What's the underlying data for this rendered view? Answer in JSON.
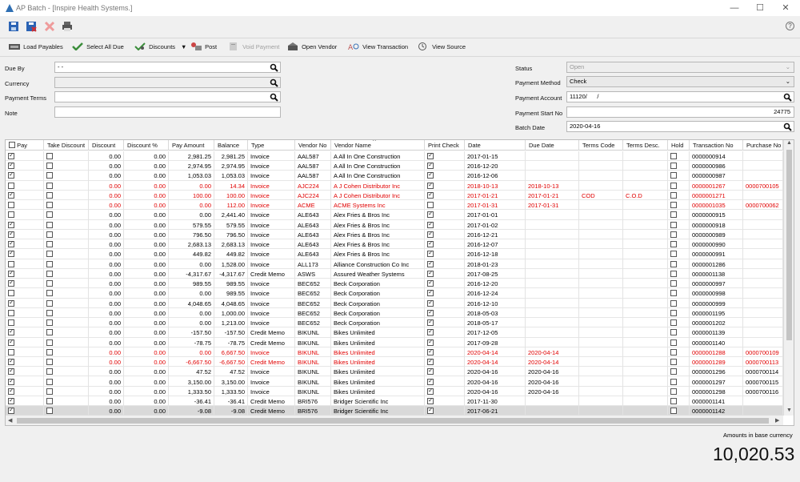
{
  "window": {
    "app_name": "AP Batch",
    "separator": "-",
    "company": "[Inspire Health Systems.]",
    "min_icon": "minimize-icon",
    "max_icon": "maximize-icon",
    "close_icon": "close-icon",
    "title_icon": "app-logo-icon"
  },
  "toolbar": {
    "help": "?",
    "buttons": [
      {
        "label": "Load Payables",
        "icon": "load-icon"
      },
      {
        "label": "Select All Due",
        "icon": "check-icon"
      },
      {
        "label": "Discounts",
        "icon": "discount-icon"
      },
      {
        "label": "▼",
        "icon": "dropdown-icon"
      },
      {
        "label": "Post",
        "icon": "post-icon"
      },
      {
        "label": "Void Payment",
        "icon": "void-icon"
      },
      {
        "label": "Open Vendor",
        "icon": "vendor-icon"
      },
      {
        "label": "View Transaction",
        "icon": "transaction-icon"
      },
      {
        "label": "View Source",
        "icon": "source-icon"
      }
    ]
  },
  "form": {
    "left": {
      "due_by_label": "Due By",
      "due_by_value": "- -",
      "currency_label": "Currency",
      "currency_value": "",
      "payment_terms_label": "Payment Terms",
      "payment_terms_value": "",
      "note_label": "Note",
      "note_value": ""
    },
    "right": {
      "status_label": "Status",
      "status_value": "Open",
      "payment_method_label": "Payment Method",
      "payment_method_value": "Check",
      "payment_account_label": "Payment Account",
      "payment_account_value": "11120/      /",
      "payment_start_label": "Payment Start No",
      "payment_start_value": "24775",
      "batch_date_label": "Batch Date",
      "batch_date_value": "2020-04-16"
    }
  },
  "grid": {
    "columns": [
      "Pay",
      "Take Discount",
      "Discount",
      "Discount %",
      "Pay Amount",
      "Balance",
      "Type",
      "Vendor No",
      "Vendor Name",
      "Print Check",
      "Date",
      "Due Date",
      "Terms Code",
      "Terms Desc.",
      "Hold",
      "Transaction No",
      "Purchase No"
    ],
    "sort_indicator": "^",
    "rows": [
      {
        "pay": true,
        "take": false,
        "discount": "0.00",
        "disc_pct": "0.00",
        "pay_amount": "2,981.25",
        "balance": "2,981.25",
        "type": "Invoice",
        "vendor_no": "AAL587",
        "vendor_name": "A All In One Construction",
        "print": true,
        "date": "2017-01-15",
        "due": "",
        "terms_code": "",
        "terms_desc": "",
        "hold": false,
        "trans": "0000000914",
        "purchase": "",
        "red": false
      },
      {
        "pay": true,
        "take": false,
        "discount": "0.00",
        "disc_pct": "0.00",
        "pay_amount": "2,974.95",
        "balance": "2,974.95",
        "type": "Invoice",
        "vendor_no": "AAL587",
        "vendor_name": "A All In One Construction",
        "print": true,
        "date": "2016-12-20",
        "due": "",
        "terms_code": "",
        "terms_desc": "",
        "hold": false,
        "trans": "0000000986",
        "purchase": "",
        "red": false
      },
      {
        "pay": true,
        "take": false,
        "discount": "0.00",
        "disc_pct": "0.00",
        "pay_amount": "1,053.03",
        "balance": "1,053.03",
        "type": "Invoice",
        "vendor_no": "AAL587",
        "vendor_name": "A All In One Construction",
        "print": true,
        "date": "2016-12-06",
        "due": "",
        "terms_code": "",
        "terms_desc": "",
        "hold": false,
        "trans": "0000000987",
        "purchase": "",
        "red": false
      },
      {
        "pay": false,
        "take": false,
        "discount": "0.00",
        "disc_pct": "0.00",
        "pay_amount": "0.00",
        "balance": "14.34",
        "type": "Invoice",
        "vendor_no": "AJC224",
        "vendor_name": "A J Cohen Distributor Inc",
        "print": true,
        "date": "2018-10-13",
        "due": "2018-10-13",
        "terms_code": "",
        "terms_desc": "",
        "hold": false,
        "trans": "0000001267",
        "purchase": "0000700105",
        "red": true
      },
      {
        "pay": true,
        "take": false,
        "discount": "0.00",
        "disc_pct": "0.00",
        "pay_amount": "100.00",
        "balance": "100.00",
        "type": "Invoice",
        "vendor_no": "AJC224",
        "vendor_name": "A J Cohen Distributor Inc",
        "print": true,
        "date": "2017-01-21",
        "due": "2017-01-21",
        "terms_code": "COD",
        "terms_desc": "C.O.D",
        "hold": false,
        "trans": "0000001271",
        "purchase": "",
        "red": true
      },
      {
        "pay": false,
        "take": false,
        "discount": "0.00",
        "disc_pct": "0.00",
        "pay_amount": "0.00",
        "balance": "112.00",
        "type": "Invoice",
        "vendor_no": "ACME",
        "vendor_name": "ACME Systems Inc",
        "print": false,
        "date": "2017-01-31",
        "due": "2017-01-31",
        "terms_code": "",
        "terms_desc": "",
        "hold": false,
        "trans": "0000001035",
        "purchase": "0000700062",
        "red": true
      },
      {
        "pay": false,
        "take": false,
        "discount": "0.00",
        "disc_pct": "0.00",
        "pay_amount": "0.00",
        "balance": "2,441.40",
        "type": "Invoice",
        "vendor_no": "ALE643",
        "vendor_name": "Alex Fries & Bros Inc",
        "print": true,
        "date": "2017-01-01",
        "due": "",
        "terms_code": "",
        "terms_desc": "",
        "hold": false,
        "trans": "0000000915",
        "purchase": "",
        "red": false
      },
      {
        "pay": true,
        "take": false,
        "discount": "0.00",
        "disc_pct": "0.00",
        "pay_amount": "579.55",
        "balance": "579.55",
        "type": "Invoice",
        "vendor_no": "ALE643",
        "vendor_name": "Alex Fries & Bros Inc",
        "print": true,
        "date": "2017-01-02",
        "due": "",
        "terms_code": "",
        "terms_desc": "",
        "hold": false,
        "trans": "0000000918",
        "purchase": "",
        "red": false
      },
      {
        "pay": true,
        "take": false,
        "discount": "0.00",
        "disc_pct": "0.00",
        "pay_amount": "796.50",
        "balance": "796.50",
        "type": "Invoice",
        "vendor_no": "ALE643",
        "vendor_name": "Alex Fries & Bros Inc",
        "print": true,
        "date": "2016-12-21",
        "due": "",
        "terms_code": "",
        "terms_desc": "",
        "hold": false,
        "trans": "0000000989",
        "purchase": "",
        "red": false
      },
      {
        "pay": true,
        "take": false,
        "discount": "0.00",
        "disc_pct": "0.00",
        "pay_amount": "2,683.13",
        "balance": "2,683.13",
        "type": "Invoice",
        "vendor_no": "ALE643",
        "vendor_name": "Alex Fries & Bros Inc",
        "print": true,
        "date": "2016-12-07",
        "due": "",
        "terms_code": "",
        "terms_desc": "",
        "hold": false,
        "trans": "0000000990",
        "purchase": "",
        "red": false
      },
      {
        "pay": true,
        "take": false,
        "discount": "0.00",
        "disc_pct": "0.00",
        "pay_amount": "449.82",
        "balance": "449.82",
        "type": "Invoice",
        "vendor_no": "ALE643",
        "vendor_name": "Alex Fries & Bros Inc",
        "print": true,
        "date": "2016-12-18",
        "due": "",
        "terms_code": "",
        "terms_desc": "",
        "hold": false,
        "trans": "0000000991",
        "purchase": "",
        "red": false
      },
      {
        "pay": false,
        "take": false,
        "discount": "0.00",
        "disc_pct": "0.00",
        "pay_amount": "0.00",
        "balance": "1,528.00",
        "type": "Invoice",
        "vendor_no": "ALL173",
        "vendor_name": "Alliance Construction Co Inc",
        "print": true,
        "date": "2018-01-23",
        "due": "",
        "terms_code": "",
        "terms_desc": "",
        "hold": false,
        "trans": "0000001286",
        "purchase": "",
        "red": false
      },
      {
        "pay": true,
        "take": false,
        "discount": "0.00",
        "disc_pct": "0.00",
        "pay_amount": "-4,317.67",
        "balance": "-4,317.67",
        "type": "Credit Memo",
        "vendor_no": "ASWS",
        "vendor_name": "Assured Weather Systems",
        "print": true,
        "date": "2017-08-25",
        "due": "",
        "terms_code": "",
        "terms_desc": "",
        "hold": false,
        "trans": "0000001138",
        "purchase": "",
        "red": false
      },
      {
        "pay": true,
        "take": false,
        "discount": "0.00",
        "disc_pct": "0.00",
        "pay_amount": "989.55",
        "balance": "989.55",
        "type": "Invoice",
        "vendor_no": "BEC652",
        "vendor_name": "Beck Corporation",
        "print": true,
        "date": "2016-12-20",
        "due": "",
        "terms_code": "",
        "terms_desc": "",
        "hold": false,
        "trans": "0000000997",
        "purchase": "",
        "red": false
      },
      {
        "pay": false,
        "take": false,
        "discount": "0.00",
        "disc_pct": "0.00",
        "pay_amount": "0.00",
        "balance": "989.55",
        "type": "Invoice",
        "vendor_no": "BEC652",
        "vendor_name": "Beck Corporation",
        "print": true,
        "date": "2016-12-24",
        "due": "",
        "terms_code": "",
        "terms_desc": "",
        "hold": false,
        "trans": "0000000998",
        "purchase": "",
        "red": false
      },
      {
        "pay": true,
        "take": false,
        "discount": "0.00",
        "disc_pct": "0.00",
        "pay_amount": "4,048.65",
        "balance": "4,048.65",
        "type": "Invoice",
        "vendor_no": "BEC652",
        "vendor_name": "Beck Corporation",
        "print": true,
        "date": "2016-12-10",
        "due": "",
        "terms_code": "",
        "terms_desc": "",
        "hold": false,
        "trans": "0000000999",
        "purchase": "",
        "red": false
      },
      {
        "pay": false,
        "take": false,
        "discount": "0.00",
        "disc_pct": "0.00",
        "pay_amount": "0.00",
        "balance": "1,000.00",
        "type": "Invoice",
        "vendor_no": "BEC652",
        "vendor_name": "Beck Corporation",
        "print": true,
        "date": "2018-05-03",
        "due": "",
        "terms_code": "",
        "terms_desc": "",
        "hold": false,
        "trans": "0000001195",
        "purchase": "",
        "red": false
      },
      {
        "pay": false,
        "take": false,
        "discount": "0.00",
        "disc_pct": "0.00",
        "pay_amount": "0.00",
        "balance": "1,213.00",
        "type": "Invoice",
        "vendor_no": "BEC652",
        "vendor_name": "Beck Corporation",
        "print": true,
        "date": "2018-05-17",
        "due": "",
        "terms_code": "",
        "terms_desc": "",
        "hold": false,
        "trans": "0000001202",
        "purchase": "",
        "red": false
      },
      {
        "pay": true,
        "take": false,
        "discount": "0.00",
        "disc_pct": "0.00",
        "pay_amount": "-157.50",
        "balance": "-157.50",
        "type": "Credit Memo",
        "vendor_no": "BIKUNL",
        "vendor_name": "Bikes Unlimited",
        "print": true,
        "date": "2017-12-05",
        "due": "",
        "terms_code": "",
        "terms_desc": "",
        "hold": false,
        "trans": "0000001139",
        "purchase": "",
        "red": false
      },
      {
        "pay": true,
        "take": false,
        "discount": "0.00",
        "disc_pct": "0.00",
        "pay_amount": "-78.75",
        "balance": "-78.75",
        "type": "Credit Memo",
        "vendor_no": "BIKUNL",
        "vendor_name": "Bikes Unlimited",
        "print": true,
        "date": "2017-09-28",
        "due": "",
        "terms_code": "",
        "terms_desc": "",
        "hold": false,
        "trans": "0000001140",
        "purchase": "",
        "red": false
      },
      {
        "pay": false,
        "take": false,
        "discount": "0.00",
        "disc_pct": "0.00",
        "pay_amount": "0.00",
        "balance": "6,667.50",
        "type": "Invoice",
        "vendor_no": "BIKUNL",
        "vendor_name": "Bikes Unlimited",
        "print": true,
        "date": "2020-04-14",
        "due": "2020-04-14",
        "terms_code": "",
        "terms_desc": "",
        "hold": false,
        "trans": "0000001288",
        "purchase": "0000700109",
        "red": true
      },
      {
        "pay": true,
        "take": false,
        "discount": "0.00",
        "disc_pct": "0.00",
        "pay_amount": "-6,667.50",
        "balance": "-6,667.50",
        "type": "Credit Memo",
        "vendor_no": "BIKUNL",
        "vendor_name": "Bikes Unlimited",
        "print": true,
        "date": "2020-04-14",
        "due": "2020-04-14",
        "terms_code": "",
        "terms_desc": "",
        "hold": false,
        "trans": "0000001289",
        "purchase": "0000700113",
        "red": true
      },
      {
        "pay": true,
        "take": false,
        "discount": "0.00",
        "disc_pct": "0.00",
        "pay_amount": "47.52",
        "balance": "47.52",
        "type": "Invoice",
        "vendor_no": "BIKUNL",
        "vendor_name": "Bikes Unlimited",
        "print": true,
        "date": "2020-04-16",
        "due": "2020-04-16",
        "terms_code": "",
        "terms_desc": "",
        "hold": false,
        "trans": "0000001296",
        "purchase": "0000700114",
        "red": false
      },
      {
        "pay": true,
        "take": false,
        "discount": "0.00",
        "disc_pct": "0.00",
        "pay_amount": "3,150.00",
        "balance": "3,150.00",
        "type": "Invoice",
        "vendor_no": "BIKUNL",
        "vendor_name": "Bikes Unlimited",
        "print": true,
        "date": "2020-04-16",
        "due": "2020-04-16",
        "terms_code": "",
        "terms_desc": "",
        "hold": false,
        "trans": "0000001297",
        "purchase": "0000700115",
        "red": false
      },
      {
        "pay": true,
        "take": false,
        "discount": "0.00",
        "disc_pct": "0.00",
        "pay_amount": "1,333.50",
        "balance": "1,333.50",
        "type": "Invoice",
        "vendor_no": "BIKUNL",
        "vendor_name": "Bikes Unlimited",
        "print": true,
        "date": "2020-04-16",
        "due": "2020-04-16",
        "terms_code": "",
        "terms_desc": "",
        "hold": false,
        "trans": "0000001298",
        "purchase": "0000700116",
        "red": false
      },
      {
        "pay": true,
        "take": false,
        "discount": "0.00",
        "disc_pct": "0.00",
        "pay_amount": "-36.41",
        "balance": "-36.41",
        "type": "Credit Memo",
        "vendor_no": "BRI576",
        "vendor_name": "Bridger Scientific Inc",
        "print": true,
        "date": "2017-11-30",
        "due": "",
        "terms_code": "",
        "terms_desc": "",
        "hold": false,
        "trans": "0000001141",
        "purchase": "",
        "red": false
      },
      {
        "pay": true,
        "take": false,
        "discount": "0.00",
        "disc_pct": "0.00",
        "pay_amount": "-9.08",
        "balance": "-9.08",
        "type": "Credit Memo",
        "vendor_no": "BRI576",
        "vendor_name": "Bridger Scientific Inc",
        "print": true,
        "date": "2017-06-21",
        "due": "",
        "terms_code": "",
        "terms_desc": "",
        "hold": false,
        "trans": "0000001142",
        "purchase": "",
        "red": false,
        "selected": true
      }
    ]
  },
  "footer": {
    "note": "Amounts in base currency",
    "total": "10,020.53"
  },
  "colors": {
    "red": "#e00000",
    "accent": "#2f6fb3"
  }
}
